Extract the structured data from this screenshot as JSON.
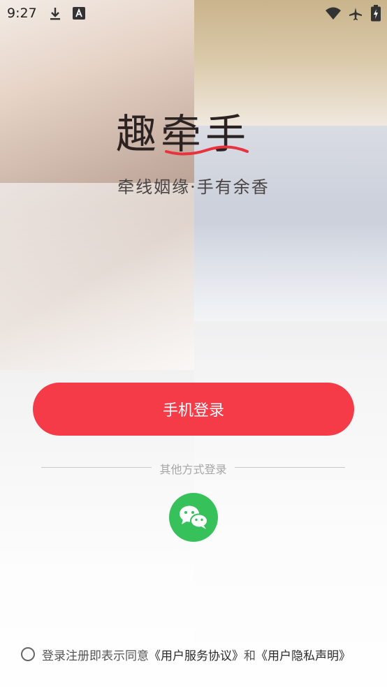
{
  "status_bar": {
    "time": "9:27",
    "icons": [
      "download-icon",
      "text-a-icon",
      "wifi-icon",
      "airplane-icon",
      "battery-charging-icon"
    ]
  },
  "logo": {
    "text": "趣牵手",
    "slogan": "牵线姻缘·手有余香"
  },
  "login": {
    "phone_button_label": "手机登录",
    "other_methods_label": "其他方式登录",
    "wechat_icon": "wechat-icon",
    "wechat_color": "#37c15b",
    "button_color": "#f63b48"
  },
  "agreement": {
    "prefix": "登录注册即表示同意",
    "terms_link": "《用户服务协议》",
    "conjunction": "和",
    "privacy_link": "《用户隐私声明》",
    "checked": false
  }
}
